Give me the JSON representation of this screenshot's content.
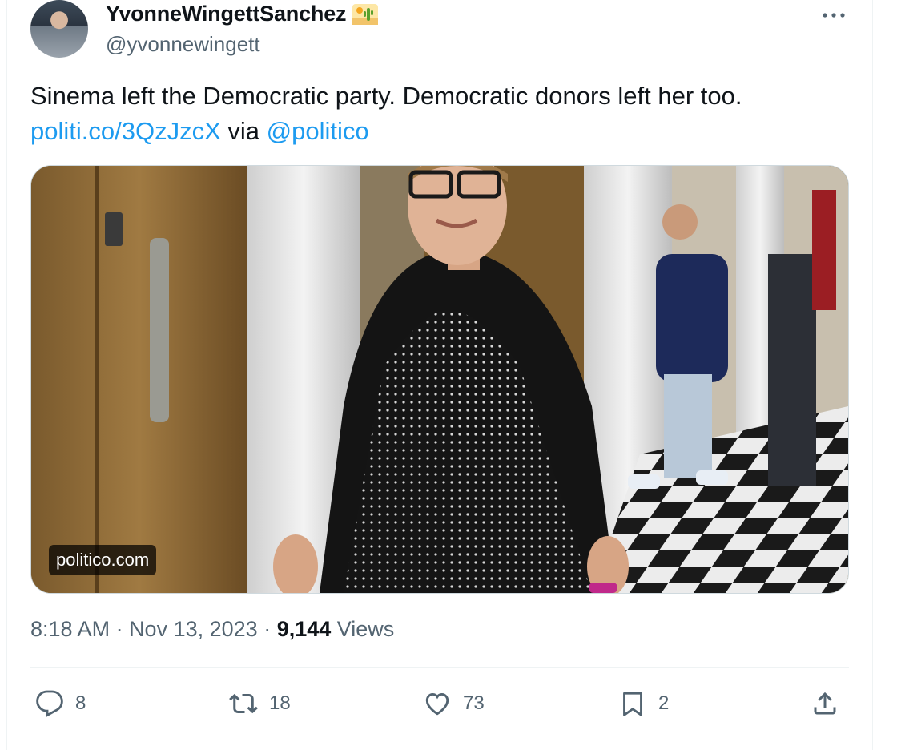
{
  "tweet": {
    "author_name": "YvonneWingettSanchez",
    "author_emoji": "desert-cactus-emoji",
    "handle": "@yvonnewingett",
    "text": "Sinema left the Democratic party. Democratic donors left her too.",
    "link_text": "politi.co/3QzJzcX",
    "via_text": " via ",
    "mention": "@politico",
    "media_domain": "politico.com",
    "time": "8:18 AM",
    "separator": " · ",
    "date": "Nov 13, 2023",
    "views_count": "9,144",
    "views_label": " Views"
  },
  "actions": {
    "replies": "8",
    "retweets": "18",
    "likes": "73",
    "bookmarks": "2"
  },
  "colors": {
    "link": "#1d9bf0",
    "secondary_text": "#536471",
    "primary_text": "#0f1419"
  }
}
